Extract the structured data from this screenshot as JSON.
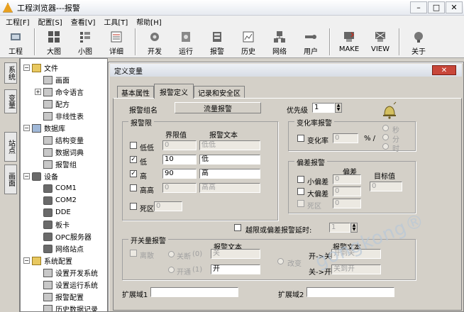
{
  "app": {
    "title": "工程浏览器---报警",
    "min": "–",
    "max": "□",
    "close": "✕"
  },
  "menu": [
    "工程[F]",
    "配置[S]",
    "查看[V]",
    "工具[T]",
    "帮助[H]"
  ],
  "toolbar": [
    {
      "label": "工程",
      "icon": "project-icon"
    },
    {
      "label": "大图",
      "icon": "large-icon-view-icon"
    },
    {
      "label": "小图",
      "icon": "small-icon-view-icon"
    },
    {
      "label": "详细",
      "icon": "detail-view-icon"
    },
    {
      "label": "开发",
      "icon": "develop-icon"
    },
    {
      "label": "运行",
      "icon": "run-icon"
    },
    {
      "label": "报警",
      "icon": "alarm-icon"
    },
    {
      "label": "历史",
      "icon": "history-icon"
    },
    {
      "label": "网络",
      "icon": "network-icon"
    },
    {
      "label": "用户",
      "icon": "user-icon"
    },
    {
      "label": "MAKE",
      "icon": "make-icon"
    },
    {
      "label": "VIEW",
      "icon": "view-icon"
    },
    {
      "label": "关于",
      "icon": "about-icon"
    }
  ],
  "side_tabs": [
    "系统",
    "变量",
    "站点",
    "画面"
  ],
  "tree": [
    {
      "label": "文件",
      "level": 0,
      "exp": "−",
      "icon": "folder"
    },
    {
      "label": "画面",
      "level": 1,
      "exp": "",
      "icon": "doc"
    },
    {
      "label": "命令语言",
      "level": 1,
      "exp": "+",
      "icon": "doc"
    },
    {
      "label": "配方",
      "level": 1,
      "exp": "",
      "icon": "doc"
    },
    {
      "label": "非线性表",
      "level": 1,
      "exp": "",
      "icon": "doc"
    },
    {
      "label": "数据库",
      "level": 0,
      "exp": "−",
      "icon": "db"
    },
    {
      "label": "结构变量",
      "level": 1,
      "exp": "",
      "icon": "doc"
    },
    {
      "label": "数据词典",
      "level": 1,
      "exp": "",
      "icon": "doc"
    },
    {
      "label": "报警组",
      "level": 1,
      "exp": "",
      "icon": "doc"
    },
    {
      "label": "设备",
      "level": 0,
      "exp": "−",
      "icon": "dev"
    },
    {
      "label": "COM1",
      "level": 1,
      "exp": "",
      "icon": "dev"
    },
    {
      "label": "COM2",
      "level": 1,
      "exp": "",
      "icon": "dev"
    },
    {
      "label": "DDE",
      "level": 1,
      "exp": "",
      "icon": "dev"
    },
    {
      "label": "板卡",
      "level": 1,
      "exp": "",
      "icon": "dev"
    },
    {
      "label": "OPC服务器",
      "level": 1,
      "exp": "",
      "icon": "dev"
    },
    {
      "label": "网络站点",
      "level": 1,
      "exp": "",
      "icon": "dev"
    },
    {
      "label": "系统配置",
      "level": 0,
      "exp": "−",
      "icon": "folder"
    },
    {
      "label": "设置开发系统",
      "level": 1,
      "exp": "",
      "icon": "doc"
    },
    {
      "label": "设置运行系统",
      "level": 1,
      "exp": "",
      "icon": "doc"
    },
    {
      "label": "报警配置",
      "level": 1,
      "exp": "",
      "icon": "doc"
    },
    {
      "label": "历史数据记录",
      "level": 1,
      "exp": "",
      "icon": "doc"
    }
  ],
  "dialog": {
    "title": "定义变量",
    "close": "✕",
    "tabs": [
      "基本属性",
      "报警定义",
      "记录和安全区"
    ],
    "active_tab": 1,
    "alarm_group_label": "报警组名",
    "alarm_group_value": "流量报警",
    "priority_label": "优先级",
    "priority_value": "1",
    "limit_group": "报警限",
    "col_limit": "界限值",
    "col_text": "报警文本",
    "limits": [
      {
        "label": "低低",
        "checked": false,
        "value": "0",
        "text": "低低"
      },
      {
        "label": "低",
        "checked": true,
        "value": "10",
        "text": "低"
      },
      {
        "label": "高",
        "checked": true,
        "value": "90",
        "text": "高"
      },
      {
        "label": "高高",
        "checked": false,
        "value": "0",
        "text": "高高"
      }
    ],
    "deadband_label": "死区",
    "deadband_value": "0",
    "rate_group": "变化率报警",
    "rate_label": "变化率",
    "rate_value": "0",
    "rate_unit": "% /",
    "rate_units": [
      "秒",
      "分",
      "时"
    ],
    "dev_group": "偏差报警",
    "dev_col": "偏差",
    "dev_rows": [
      {
        "label": "小偏差",
        "value": "0"
      },
      {
        "label": "大偏差",
        "value": "0"
      },
      {
        "label": "死区",
        "value": "0"
      }
    ],
    "target_label": "目标值",
    "target_value": "0",
    "delay_label": "越限或偏差报警延时:",
    "delay_value": "1",
    "switch_group": "开关量报警",
    "switch_discrete": "离散",
    "switch_text_hdr": "报警文本",
    "switch_off": "关断",
    "switch_off_key": "(0)",
    "switch_off_text": "关",
    "switch_on": "开通",
    "switch_on_key": "(1)",
    "switch_on_text": "开",
    "switch_change": "改变",
    "switch_text_hdr2": "报警文本",
    "on_to_off": "开->关",
    "on_to_off_text": "开到关",
    "off_to_on": "关->开",
    "off_to_on_text": "关到开",
    "ext1": "扩展域1",
    "ext2": "扩展域2"
  },
  "watermark": "gongkong®"
}
